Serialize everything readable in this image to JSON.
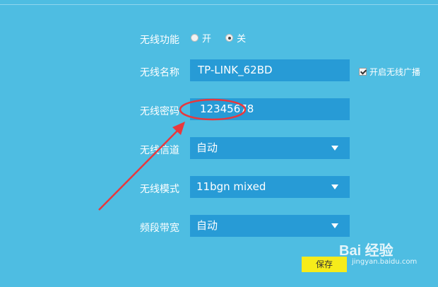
{
  "wireless_function": {
    "label": "无线功能",
    "options": [
      "开",
      "关"
    ],
    "selected": "关"
  },
  "wireless_name": {
    "label": "无线名称",
    "value": "TP-LINK_62BD",
    "broadcast_label": "开启无线广播",
    "broadcast_checked": true
  },
  "wireless_password": {
    "label": "无线密码",
    "value": "12345678"
  },
  "wireless_channel": {
    "label": "无线信道",
    "value": "自动"
  },
  "wireless_mode": {
    "label": "无线模式",
    "value": "11bgn mixed"
  },
  "bandwidth": {
    "label": "频段带宽",
    "value": "自动"
  },
  "save_label": "保存",
  "watermark": {
    "logo": "Bai 经验",
    "sub": "jingyan.baidu.com"
  },
  "colors": {
    "background": "#4ebde2",
    "field": "#279bd6",
    "annotation": "#e8383d",
    "save": "#f6ec1a"
  }
}
